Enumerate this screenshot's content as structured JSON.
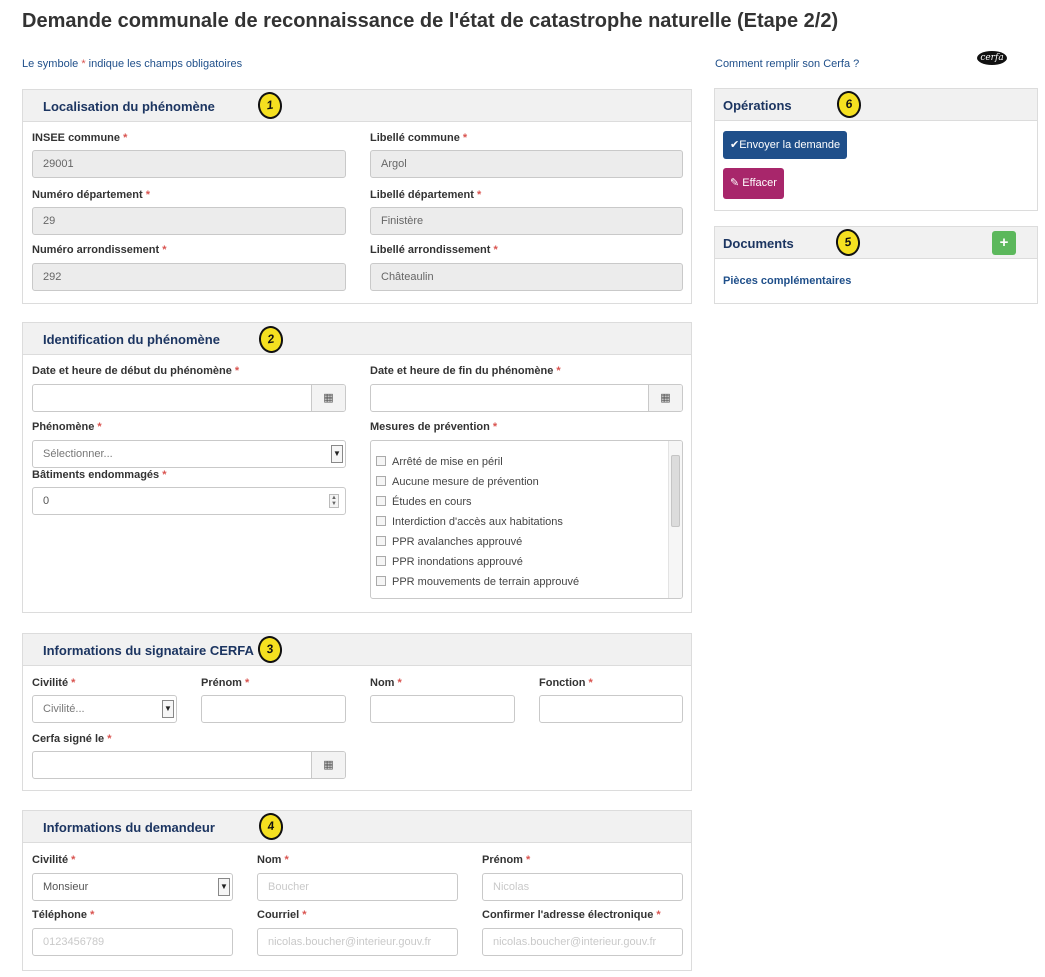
{
  "page_title": "Demande communale de reconnaissance de l'état de catastrophe naturelle (Etape 2/2)",
  "mandatory_note": {
    "prefix": "Le symbole ",
    "star": "*",
    "suffix": " indique les champs obligatoires"
  },
  "help_link": "Comment remplir son Cerfa ?",
  "cerfa_logo": "cerfa",
  "required_marker": "*",
  "colors": {
    "primary": "#1f4f8a",
    "danger": "#a8266b",
    "success": "#5cb85c",
    "badge": "#f5e020"
  },
  "localisation": {
    "title": "Localisation du phénomène",
    "badge": "1",
    "insee_label": "INSEE commune",
    "insee_value": "29001",
    "commune_label": "Libellé commune",
    "commune_value": "Argol",
    "dept_num_label": "Numéro département",
    "dept_num_value": "29",
    "dept_label": "Libellé département",
    "dept_value": "Finistère",
    "arr_num_label": "Numéro arrondissement",
    "arr_num_value": "292",
    "arr_label": "Libellé arrondissement",
    "arr_value": "Châteaulin"
  },
  "identification": {
    "title": "Identification du phénomène",
    "badge": "2",
    "start_label": "Date et heure de début du phénomène",
    "end_label": "Date et heure de fin du phénomène",
    "phenomene_label": "Phénomène",
    "phenomene_placeholder": "Sélectionner...",
    "batiments_label": "Bâtiments endommagés",
    "batiments_value": "0",
    "mesures_label": "Mesures de prévention",
    "mesures_options": [
      "Arrêté de mise en péril",
      "Aucune mesure de prévention",
      "Études en cours",
      "Interdiction d'accès aux habitations",
      "PPR avalanches approuvé",
      "PPR inondations approuvé",
      "PPR mouvements de terrain approuvé"
    ]
  },
  "signataire": {
    "title": "Informations du signataire CERFA",
    "badge": "3",
    "civilite_label": "Civilité",
    "civilite_placeholder": "Civilité...",
    "prenom_label": "Prénom",
    "nom_label": "Nom",
    "fonction_label": "Fonction",
    "signe_label": "Cerfa signé le"
  },
  "demandeur": {
    "title": "Informations du demandeur",
    "badge": "4",
    "civilite_label": "Civilité",
    "civilite_value": "Monsieur",
    "nom_label": "Nom",
    "nom_value": "Boucher",
    "prenom_label": "Prénom",
    "prenom_value": "Nicolas",
    "tel_label": "Téléphone",
    "tel_value": "0123456789",
    "courriel_label": "Courriel",
    "courriel_value": "nicolas.boucher@interieur.gouv.fr",
    "confirm_label": "Confirmer l'adresse électronique",
    "confirm_value": "nicolas.boucher@interieur.gouv.fr"
  },
  "operations": {
    "title": "Opérations",
    "badge": "6",
    "send_label": "Envoyer la demande",
    "clear_label": "Effacer"
  },
  "documents": {
    "title": "Documents",
    "badge": "5",
    "add_label": "+",
    "pieces_label": "Pièces complémentaires"
  }
}
